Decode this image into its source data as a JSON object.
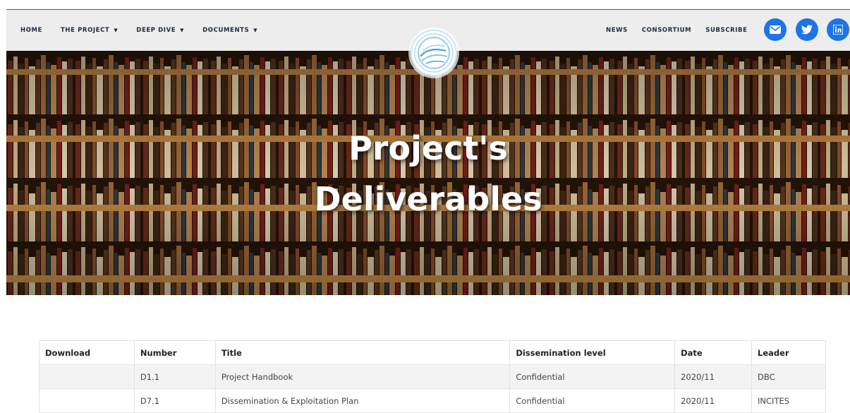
{
  "nav": {
    "left": [
      {
        "label": "HOME",
        "dropdown": false
      },
      {
        "label": "THE PROJECT",
        "dropdown": true
      },
      {
        "label": "DEEP DIVE",
        "dropdown": true
      },
      {
        "label": "DOCUMENTS",
        "dropdown": true
      }
    ],
    "right": [
      {
        "label": "NEWS"
      },
      {
        "label": "CONSORTIUM"
      },
      {
        "label": "SUBSCRIBE"
      }
    ],
    "social": [
      {
        "icon": "email-icon"
      },
      {
        "icon": "twitter-icon"
      },
      {
        "icon": "linkedin-icon"
      }
    ],
    "caret": "▼"
  },
  "hero": {
    "title_line1": "Project's",
    "title_line2": "Deliverables"
  },
  "table": {
    "headers": [
      "Download",
      "Number",
      "Title",
      "Dissemination level",
      "Date",
      "Leader"
    ],
    "rows": [
      [
        "",
        "D1.1",
        "Project Handbook",
        "Confidential",
        "2020/11",
        "DBC"
      ],
      [
        "",
        "D7.1",
        "Dissemination & Exploitation Plan",
        "Confidential",
        "2020/11",
        "INCITES"
      ]
    ]
  },
  "colors": {
    "social": "#1b75e8",
    "navbar": "#ededed",
    "nav_text": "#1f2a3a"
  }
}
